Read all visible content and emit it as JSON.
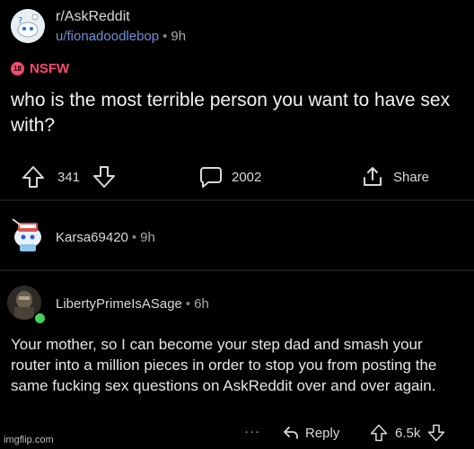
{
  "post": {
    "subreddit": "r/AskReddit",
    "author": "u/fionadoodlebop",
    "age": "9h",
    "separator": "•",
    "nsfw_label": "NSFW",
    "nsfw_badge": "18",
    "title": "who is the most terrible person you want to have sex with?",
    "upvotes": "341",
    "comments": "2002",
    "share_label": "Share"
  },
  "comments": [
    {
      "author": "Karsa69420",
      "age": "9h"
    },
    {
      "author": "LibertyPrimeIsASage",
      "age": "6h",
      "body": "Your mother, so I can become your step dad and smash your router into a million pieces in order to stop you from posting the same fucking sex questions on AskReddit over and over again.",
      "more": "···",
      "reply_label": "Reply",
      "score": "6.5k"
    }
  ],
  "watermark": "imgflip.com",
  "colors": {
    "background": "#000000",
    "author_link": "#6f8fd6",
    "nsfw": "#ff4a6e",
    "online": "#46d160"
  }
}
